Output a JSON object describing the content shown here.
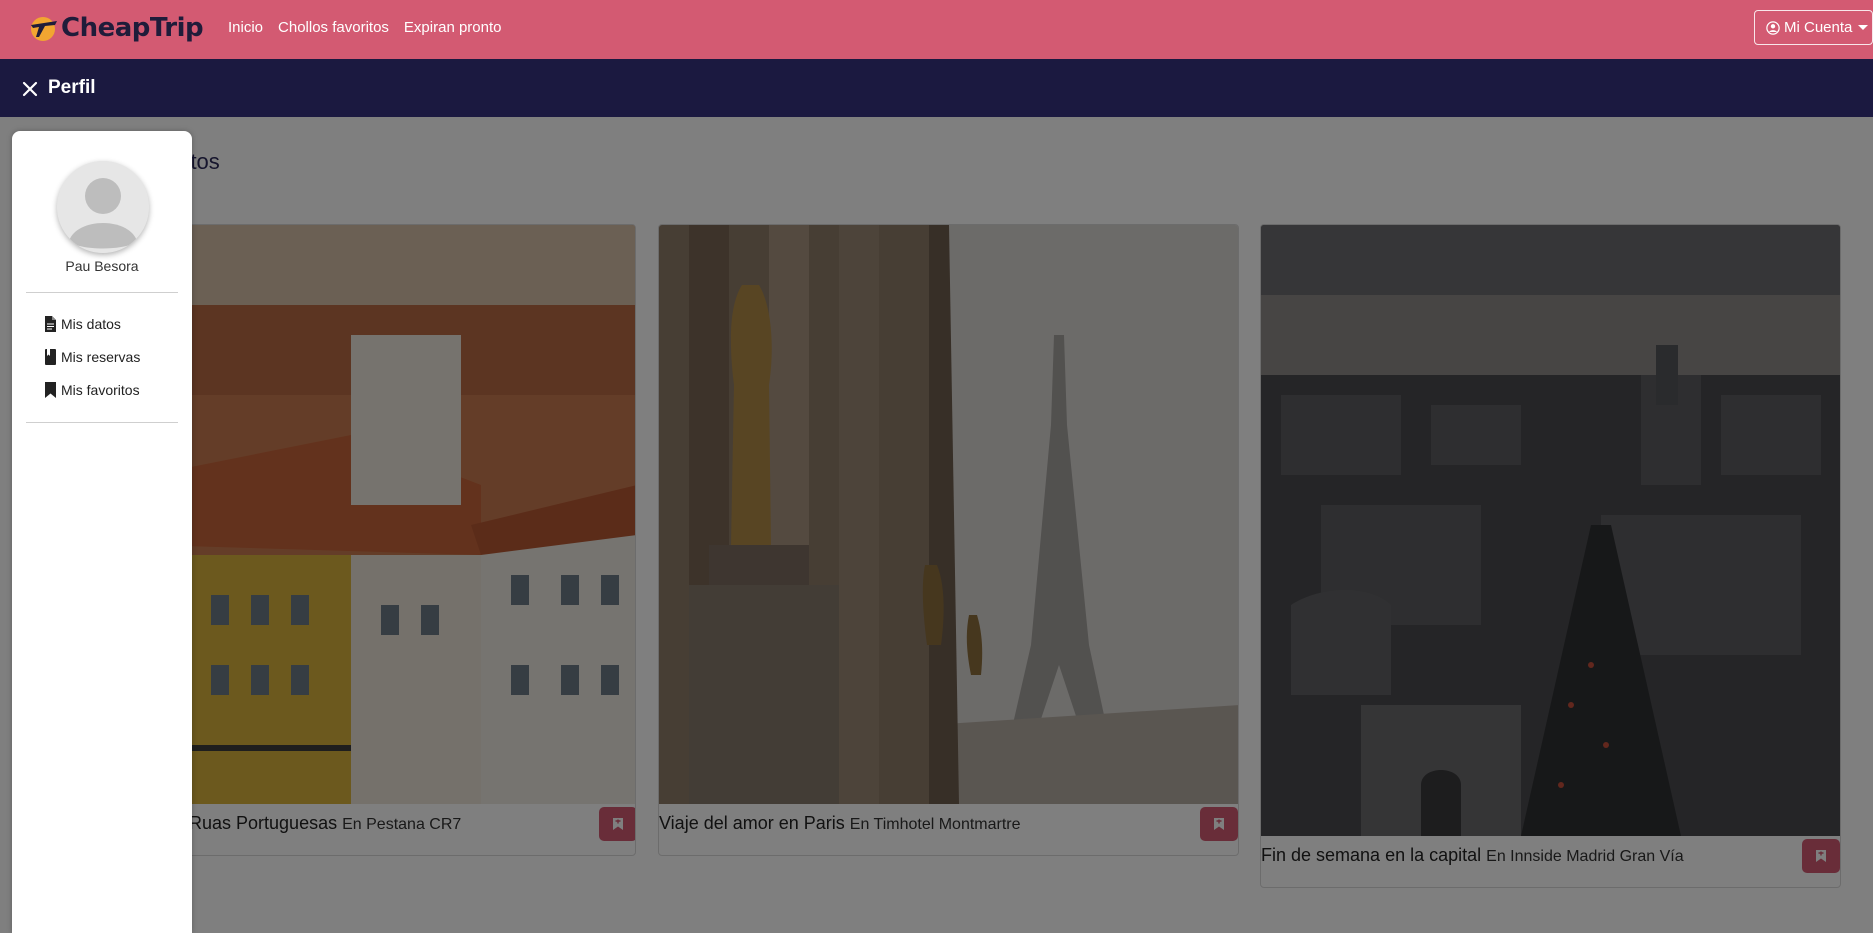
{
  "navbar": {
    "logo_text": "CheapTrip",
    "links": [
      "Inicio",
      "Chollos favoritos",
      "Expiran pronto"
    ],
    "account_label": "Mi Cuenta"
  },
  "profile_bar": {
    "title": "Perfil"
  },
  "sidebar": {
    "user_name": "Pau Besora",
    "items": [
      {
        "label": "Mis datos",
        "icon": "document-icon"
      },
      {
        "label": "Mis reservas",
        "icon": "book-icon"
      },
      {
        "label": "Mis favoritos",
        "icon": "bookmark-icon"
      }
    ]
  },
  "main": {
    "section_title": "voritos",
    "cards": [
      {
        "title": "Ruas Portuguesas",
        "hotel": "En Pestana CR7"
      },
      {
        "title": "Viaje del amor en Paris",
        "hotel": "En Timhotel Montmartre"
      },
      {
        "title": "Fin de semana en la capital",
        "hotel": "En Innside Madrid Gran Vía"
      }
    ]
  },
  "colors": {
    "navbar": "#d35a72",
    "profile_bar": "#1b1940",
    "accent": "#d35a72"
  }
}
